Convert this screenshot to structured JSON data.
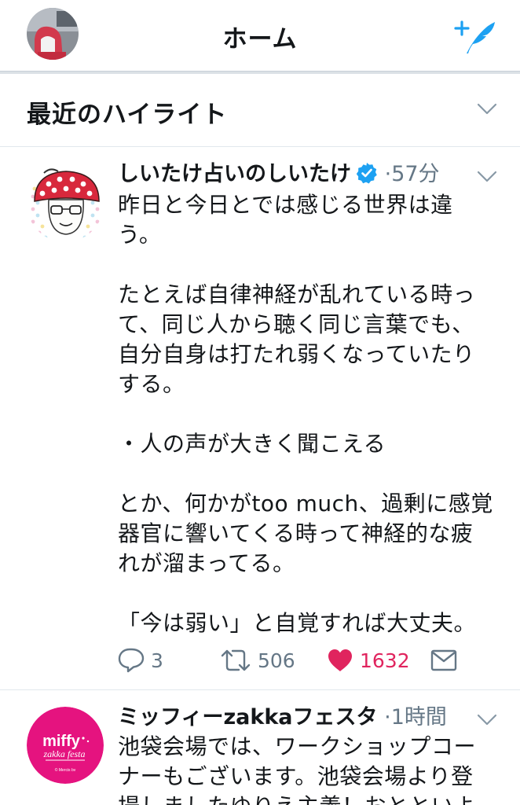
{
  "header": {
    "title": "ホーム"
  },
  "highlights": {
    "label": "最近のハイライト"
  },
  "tweets": [
    {
      "name": "しいたけ占いのしいたけ",
      "verified": true,
      "separator": "·",
      "time": "57分",
      "text": "昨日と今日とでは感じる世界は違う。\n\nたとえば自律神経が乱れている時って、同じ人から聴く同じ言葉でも、自分自身は打たれ弱くなっていたりする。\n\n・人の声が大きく聞こえる\n\nとか、何かがtoo much、過剰に感覚器官に響いてくる時って神経的な疲れが溜まってる。\n\n「今は弱い」と自覚すれば大丈夫。",
      "reply_count": "3",
      "retweet_count": "506",
      "like_count": "1632",
      "liked": true
    },
    {
      "name": "ミッフィーzakkaフェスタ",
      "verified": false,
      "separator": "·",
      "time": "1時間",
      "text": "池袋会場では、ワークショップコーナーもございます。池袋会場より登場しましたゆりえ主義！おとといよ",
      "avatar_text_main": "miffy",
      "avatar_text_sub": "zakka festa",
      "avatar_text_small": "© Mercis bv"
    }
  ],
  "colors": {
    "accent": "#1da1f2",
    "like": "#e0245e",
    "secondary_text": "#657786",
    "miffy_pink": "#e5137f"
  }
}
